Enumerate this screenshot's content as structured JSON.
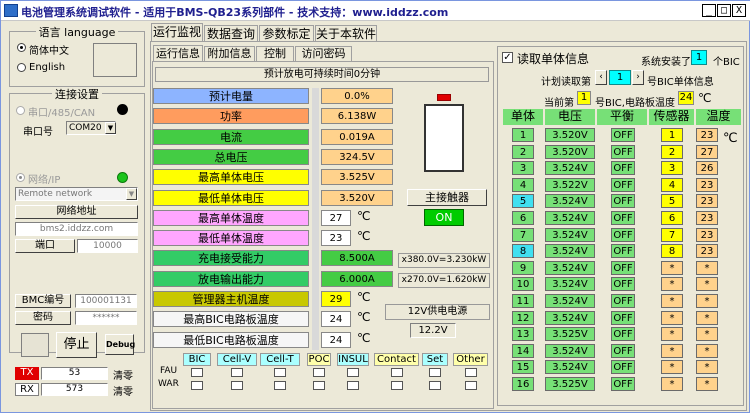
{
  "title": "电池管理系统调试软件 - 适用于BMS-QB23系列部件 - 技术支持：www.iddzz.com",
  "win_btns": [
    "_",
    "□",
    "X"
  ],
  "tabs": [
    "运行监视",
    "数据查询",
    "参数标定",
    "关于本软件"
  ],
  "subtabs": [
    "运行信息",
    "附加信息",
    "控制",
    "访问密码"
  ],
  "left": {
    "lang_title": "语言 language",
    "lang_zh": "简体中文",
    "lang_en": "English",
    "conn_title": "连接设置",
    "serial": "串口/485/CAN",
    "port_label": "串口号",
    "port_value": "COM20",
    "net": "网络/IP",
    "net_select": "Remote network",
    "addr_btn": "网络地址",
    "addr_value": "bms2.iddzz.com",
    "port2_btn": "端口",
    "port2_value": "10000",
    "bmc_label": "BMC编号",
    "bmc_value": "100001131",
    "pwd_label": "密码",
    "pwd_value": "******",
    "stop": "停止",
    "debug": "Debug",
    "tx": "TX",
    "tx_count": "53",
    "rx": "RX",
    "rx_count": "573",
    "clear": "清零"
  },
  "main": {
    "banner": "预计放电可持续时间0分钟",
    "rows": [
      {
        "label": "预计电量",
        "value": "0.0%",
        "unit": ""
      },
      {
        "label": "功率",
        "value": "6.138W",
        "unit": ""
      },
      {
        "label": "电流",
        "value": "0.019A",
        "unit": ""
      },
      {
        "label": "总电压",
        "value": "324.5V",
        "unit": ""
      },
      {
        "label": "最高单体电压",
        "value": "3.525V",
        "unit": ""
      },
      {
        "label": "最低单体电压",
        "value": "3.520V",
        "unit": ""
      },
      {
        "label": "最高单体温度",
        "value": "27",
        "unit": "℃"
      },
      {
        "label": "最低单体温度",
        "value": "23",
        "unit": "℃"
      },
      {
        "label": "充电接受能力",
        "value": "8.500A",
        "unit": ""
      },
      {
        "label": "放电输出能力",
        "value": "6.000A",
        "unit": ""
      },
      {
        "label": "管理器主机温度",
        "value": "29",
        "unit": "℃"
      },
      {
        "label": "最高BIC电路板温度",
        "value": "24",
        "unit": "℃"
      },
      {
        "label": "最低BIC电路板温度",
        "value": "24",
        "unit": "℃"
      }
    ],
    "main_relay": "主接触器",
    "main_relay_state": "ON",
    "charge_cap": "x380.0V=3.230kW",
    "discharge_cap": "x270.0V=1.620kW",
    "power_label": "12V供电电源",
    "power_value": "12.2V",
    "flags": [
      "BIC",
      "Cell-V",
      "Cell-T",
      "POC",
      "INSUL",
      "Contact",
      "Set",
      "Other"
    ],
    "fau": "FAU",
    "war": "WAR"
  },
  "right": {
    "read_cells": "读取单体信息",
    "installed_pre": "系统安装了",
    "installed": "1",
    "installed_post": "个BIC",
    "plan_label": "计划读取第",
    "plan_value": "1",
    "plan_post": "号BIC单体信息",
    "cur_pre": "当前第",
    "cur_value": "1",
    "cur_post": "号BIC,电路板温度",
    "board_temp": "24",
    "board_unit": "℃",
    "headers": [
      "单体",
      "电压",
      "平衡",
      "传感器",
      "温度"
    ],
    "temp_unit": "℃",
    "cells": [
      {
        "n": "1",
        "v": "3.520V",
        "b": "OFF",
        "s": "1",
        "t": "23"
      },
      {
        "n": "2",
        "v": "3.520V",
        "b": "OFF",
        "s": "2",
        "t": "27"
      },
      {
        "n": "3",
        "v": "3.524V",
        "b": "OFF",
        "s": "3",
        "t": "26"
      },
      {
        "n": "4",
        "v": "3.522V",
        "b": "OFF",
        "s": "4",
        "t": "23"
      },
      {
        "n": "5",
        "v": "3.524V",
        "b": "OFF",
        "s": "5",
        "t": "23"
      },
      {
        "n": "6",
        "v": "3.524V",
        "b": "OFF",
        "s": "6",
        "t": "23"
      },
      {
        "n": "7",
        "v": "3.524V",
        "b": "OFF",
        "s": "7",
        "t": "23"
      },
      {
        "n": "8",
        "v": "3.524V",
        "b": "OFF",
        "s": "8",
        "t": "23"
      },
      {
        "n": "9",
        "v": "3.524V",
        "b": "OFF",
        "s": "*",
        "t": "*"
      },
      {
        "n": "10",
        "v": "3.524V",
        "b": "OFF",
        "s": "*",
        "t": "*"
      },
      {
        "n": "11",
        "v": "3.524V",
        "b": "OFF",
        "s": "*",
        "t": "*"
      },
      {
        "n": "12",
        "v": "3.524V",
        "b": "OFF",
        "s": "*",
        "t": "*"
      },
      {
        "n": "13",
        "v": "3.525V",
        "b": "OFF",
        "s": "*",
        "t": "*"
      },
      {
        "n": "14",
        "v": "3.524V",
        "b": "OFF",
        "s": "*",
        "t": "*"
      },
      {
        "n": "15",
        "v": "3.524V",
        "b": "OFF",
        "s": "*",
        "t": "*"
      },
      {
        "n": "16",
        "v": "3.525V",
        "b": "OFF",
        "s": "*",
        "t": "*"
      }
    ]
  }
}
